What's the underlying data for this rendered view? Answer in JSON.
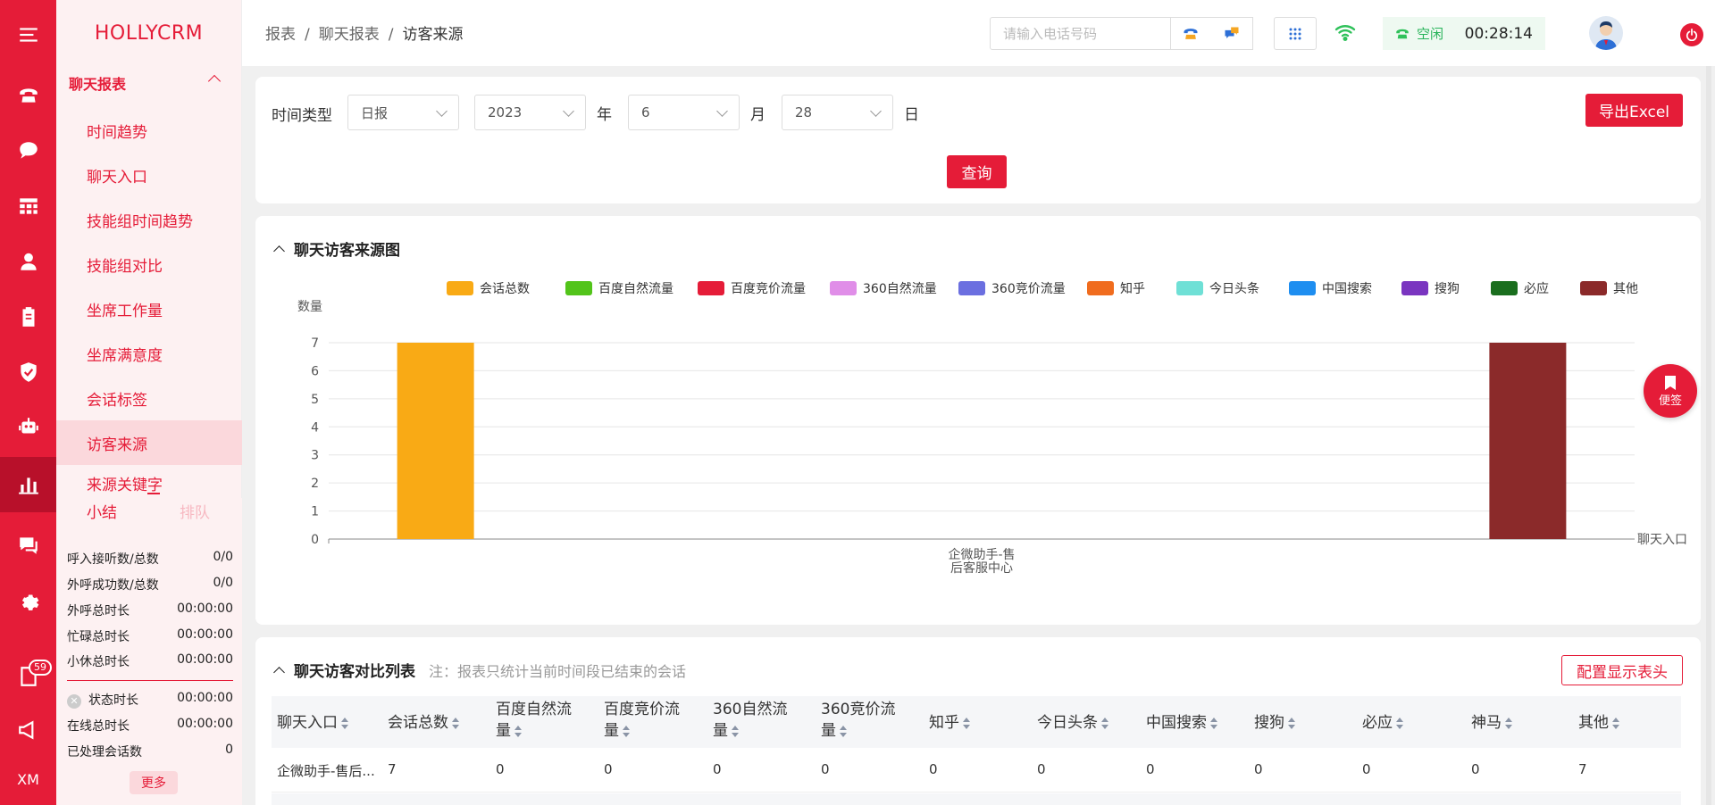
{
  "app": {
    "brand": "HOLLYCRM"
  },
  "rail": {
    "icons": [
      "menu-icon",
      "phone-icon",
      "chat-icon",
      "grid-icon",
      "user-icon",
      "clipboard-icon",
      "shield-icon",
      "robot-icon",
      "bar-chart-icon",
      "message-icon",
      "gear-icon",
      "book-icon",
      "megaphone-icon"
    ],
    "badge_count": "59",
    "bottom_text": "XM"
  },
  "menu": {
    "group": "聊天报表",
    "items": [
      "时间趋势",
      "聊天入口",
      "技能组时间趋势",
      "技能组对比",
      "坐席工作量",
      "坐席满意度",
      "会话标签",
      "访客来源",
      "来源关键字"
    ],
    "active": "访客来源"
  },
  "summary": {
    "tab_active": "小结",
    "tab_other": "排队",
    "rows": [
      {
        "label": "呼入接听数/总数",
        "value": "0/0"
      },
      {
        "label": "外呼成功数/总数",
        "value": "0/0"
      },
      {
        "label": "外呼总时长",
        "value": "00:00:00"
      },
      {
        "label": "忙碌总时长",
        "value": "00:00:00"
      },
      {
        "label": "小休总时长",
        "value": "00:00:00"
      }
    ],
    "rows2": [
      {
        "label": "状态时长",
        "value": "00:00:00"
      },
      {
        "label": "在线总时长",
        "value": "00:00:00"
      },
      {
        "label": "已处理会话数",
        "value": "0"
      }
    ],
    "more_label": "更多"
  },
  "topbar": {
    "breadcrumb": [
      "报表",
      "聊天报表",
      "访客来源"
    ],
    "phone_placeholder": "请输入电话号码",
    "status": "空闲",
    "timer": "00:28:14"
  },
  "filters": {
    "time_type_label": "时间类型",
    "time_type_value": "日报",
    "year": "2023",
    "year_unit": "年",
    "month": "6",
    "month_unit": "月",
    "day": "28",
    "day_unit": "日",
    "export_label": "导出Excel",
    "query_label": "查询"
  },
  "chart_section": {
    "title": "聊天访客来源图"
  },
  "chart_data": {
    "type": "bar",
    "ylabel": "数量",
    "xlabel": "聊天入口",
    "categories": [
      "企微助手-售后客服中心"
    ],
    "category_lines": [
      "企微助手-售",
      "后客服中心"
    ],
    "ylim": [
      0,
      7
    ],
    "yticks": [
      "0",
      "1",
      "2",
      "3",
      "4",
      "5",
      "6",
      "7"
    ],
    "grid": true,
    "legend_position": "top",
    "series": [
      {
        "name": "会话总数",
        "color": "#f9aa15",
        "values": [
          7
        ]
      },
      {
        "name": "百度自然流量",
        "color": "#52c41a",
        "values": [
          0
        ]
      },
      {
        "name": "百度竞价流量",
        "color": "#e51c38",
        "values": [
          0
        ]
      },
      {
        "name": "360自然流量",
        "color": "#e08ee8",
        "values": [
          0
        ]
      },
      {
        "name": "360竞价流量",
        "color": "#6b6fe0",
        "values": [
          0
        ]
      },
      {
        "name": "知乎",
        "color": "#f06c1e",
        "values": [
          0
        ]
      },
      {
        "name": "今日头条",
        "color": "#6fe0d6",
        "values": [
          0
        ]
      },
      {
        "name": "中国搜索",
        "color": "#1e8ef0",
        "values": [
          0
        ]
      },
      {
        "name": "搜狗",
        "color": "#7a35c0",
        "values": [
          0
        ]
      },
      {
        "name": "必应",
        "color": "#1a6e1e",
        "values": [
          0
        ]
      },
      {
        "name": "其他",
        "color": "#8b2a2a",
        "values": [
          7
        ]
      }
    ]
  },
  "float_button": {
    "label": "便签"
  },
  "table_section": {
    "title": "聊天访客对比列表",
    "note": "注：报表只统计当前时间段已结束的会话",
    "config_label": "配置显示表头",
    "columns": [
      {
        "l1": "聊天入口",
        "l2": ""
      },
      {
        "l1": "会话总数",
        "l2": ""
      },
      {
        "l1": "百度自然流",
        "l2": "量"
      },
      {
        "l1": "百度竞价流",
        "l2": "量"
      },
      {
        "l1": "360自然流",
        "l2": "量"
      },
      {
        "l1": "360竞价流",
        "l2": "量"
      },
      {
        "l1": "知乎",
        "l2": ""
      },
      {
        "l1": "今日头条",
        "l2": ""
      },
      {
        "l1": "中国搜索",
        "l2": ""
      },
      {
        "l1": "搜狗",
        "l2": ""
      },
      {
        "l1": "必应",
        "l2": ""
      },
      {
        "l1": "神马",
        "l2": ""
      },
      {
        "l1": "其他",
        "l2": ""
      }
    ],
    "rows": [
      [
        "企微助手-售后...",
        "7",
        "0",
        "0",
        "0",
        "0",
        "0",
        "0",
        "0",
        "0",
        "0",
        "0",
        "7"
      ]
    ]
  }
}
